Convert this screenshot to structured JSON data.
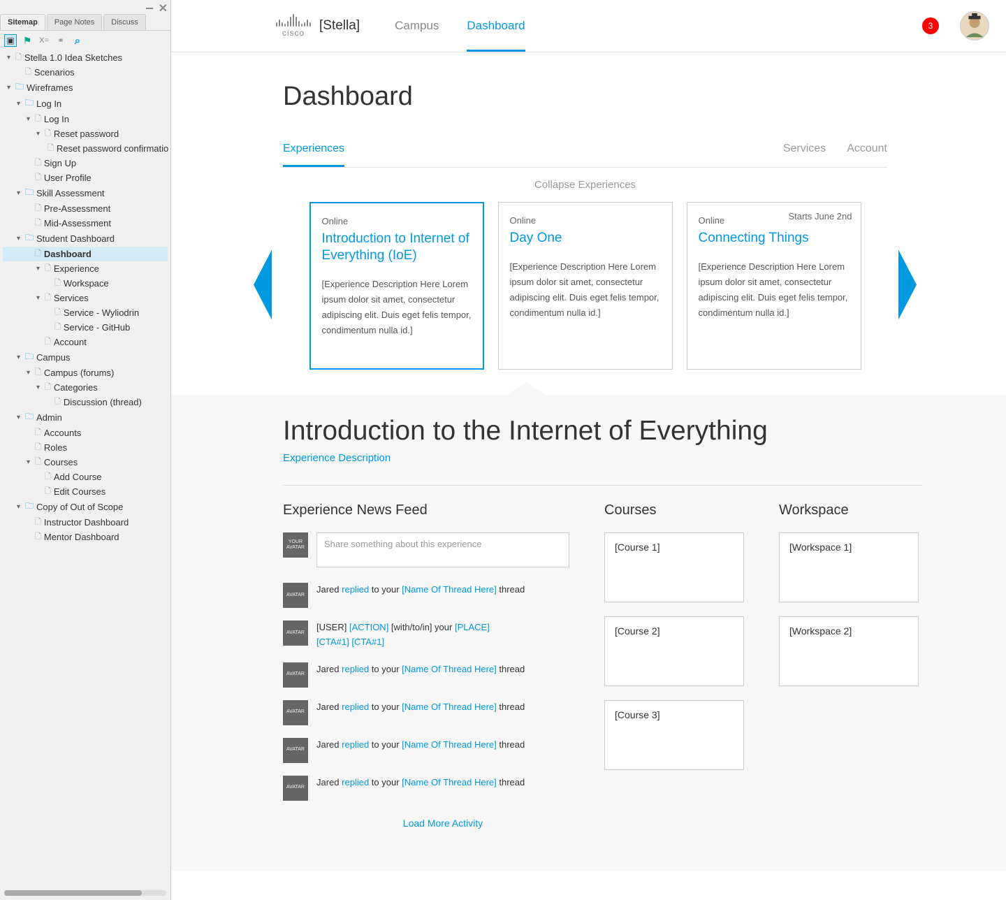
{
  "sidebar": {
    "tabs": [
      "Sitemap",
      "Page Notes",
      "Discuss"
    ],
    "tree": [
      {
        "indent": 0,
        "caret": "▾",
        "type": "page",
        "label": "Stella 1.0 Idea Sketches"
      },
      {
        "indent": 1,
        "caret": "",
        "type": "page",
        "label": "Scenarios"
      },
      {
        "indent": 0,
        "caret": "▾",
        "type": "folder",
        "label": "Wireframes"
      },
      {
        "indent": 1,
        "caret": "▾",
        "type": "folder",
        "label": "Log In"
      },
      {
        "indent": 2,
        "caret": "▾",
        "type": "page",
        "label": "Log In"
      },
      {
        "indent": 3,
        "caret": "▾",
        "type": "page",
        "label": "Reset password"
      },
      {
        "indent": 4,
        "caret": "",
        "type": "page",
        "label": "Reset password confirmatio"
      },
      {
        "indent": 2,
        "caret": "",
        "type": "page",
        "label": "Sign Up"
      },
      {
        "indent": 2,
        "caret": "",
        "type": "page",
        "label": "User Profile"
      },
      {
        "indent": 1,
        "caret": "▾",
        "type": "folder",
        "label": "Skill Assessment"
      },
      {
        "indent": 2,
        "caret": "",
        "type": "page",
        "label": "Pre-Assessment"
      },
      {
        "indent": 2,
        "caret": "",
        "type": "page",
        "label": "Mid-Assessment"
      },
      {
        "indent": 1,
        "caret": "▾",
        "type": "folder",
        "label": "Student Dashboard"
      },
      {
        "indent": 2,
        "caret": "",
        "type": "page",
        "label": "Dashboard",
        "selected": true
      },
      {
        "indent": 3,
        "caret": "▾",
        "type": "page",
        "label": "Experience"
      },
      {
        "indent": 4,
        "caret": "",
        "type": "page",
        "label": "Workspace"
      },
      {
        "indent": 3,
        "caret": "▾",
        "type": "page",
        "label": "Services"
      },
      {
        "indent": 4,
        "caret": "",
        "type": "page",
        "label": "Service - Wyliodrin"
      },
      {
        "indent": 4,
        "caret": "",
        "type": "page",
        "label": "Service - GitHub"
      },
      {
        "indent": 3,
        "caret": "",
        "type": "page",
        "label": "Account"
      },
      {
        "indent": 1,
        "caret": "▾",
        "type": "folder",
        "label": "Campus"
      },
      {
        "indent": 2,
        "caret": "▾",
        "type": "page",
        "label": "Campus (forums)"
      },
      {
        "indent": 3,
        "caret": "▾",
        "type": "page",
        "label": "Categories"
      },
      {
        "indent": 4,
        "caret": "",
        "type": "page",
        "label": "Discussion (thread)"
      },
      {
        "indent": 1,
        "caret": "▾",
        "type": "folder",
        "label": "Admin"
      },
      {
        "indent": 2,
        "caret": "",
        "type": "page",
        "label": "Accounts"
      },
      {
        "indent": 2,
        "caret": "",
        "type": "page",
        "label": "Roles"
      },
      {
        "indent": 2,
        "caret": "▾",
        "type": "page",
        "label": "Courses"
      },
      {
        "indent": 3,
        "caret": "",
        "type": "page",
        "label": "Add Course"
      },
      {
        "indent": 3,
        "caret": "",
        "type": "page",
        "label": "Edit Courses"
      },
      {
        "indent": 1,
        "caret": "▾",
        "type": "folder",
        "label": "Copy of Out of Scope"
      },
      {
        "indent": 2,
        "caret": "",
        "type": "page",
        "label": "Instructor Dashboard"
      },
      {
        "indent": 2,
        "caret": "",
        "type": "page",
        "label": "Mentor Dashboard"
      }
    ]
  },
  "header": {
    "brand": "[Stella]",
    "nav": [
      "Campus",
      "Dashboard"
    ],
    "badge": "3"
  },
  "page": {
    "title": "Dashboard",
    "subtabs": [
      "Experiences",
      "Services",
      "Account"
    ],
    "collapse": "Collapse Experiences"
  },
  "cards": [
    {
      "tag": "Online",
      "title": "Introduction to Internet of Everything (IoE)",
      "desc": "[Experience Description Here Lorem ipsum dolor sit amet, consectetur adipiscing elit. Duis eget felis tempor, condimentum nulla id.]"
    },
    {
      "tag": "Online",
      "title": "Day One",
      "desc": "[Experience Description Here Lorem ipsum dolor sit amet, consectetur adipiscing elit. Duis eget felis tempor, condimentum nulla id.]"
    },
    {
      "tag": "Online",
      "starts": "Starts June 2nd",
      "title": "Connecting Things",
      "desc": "[Experience Description Here Lorem ipsum dolor sit amet, consectetur adipiscing elit. Duis eget felis tempor, condimentum nulla id.]"
    }
  ],
  "detail": {
    "title": "Introduction to the Internet of Everything",
    "link": "Experience Description",
    "feed_head": "Experience News Feed",
    "courses_head": "Courses",
    "ws_head": "Workspace",
    "share_avatar": "YOUR AVATAR",
    "share_placeholder": "Share something about this experience",
    "load_more": "Load More Activity",
    "avatar_label": "AVATAR",
    "feed": [
      {
        "user": "Jared",
        "action": "replied",
        "mid": "to your",
        "place": "[Name Of Thread Here]",
        "tail": "thread"
      },
      {
        "user": "[USER]",
        "action": "[ACTION]",
        "mid": "[with/to/in] your",
        "place": "[PLACE]",
        "cta1": "[CTA#1]",
        "cta2": "[CTA#1]"
      },
      {
        "user": "Jared",
        "action": "replied",
        "mid": "to your",
        "place": "[Name Of Thread Here]",
        "tail": "thread"
      },
      {
        "user": "Jared",
        "action": "replied",
        "mid": "to your",
        "place": "[Name Of Thread Here]",
        "tail": "thread"
      },
      {
        "user": "Jared",
        "action": "replied",
        "mid": "to your",
        "place": "[Name Of Thread Here]",
        "tail": "thread"
      },
      {
        "user": "Jared",
        "action": "replied",
        "mid": "to your",
        "place": "[Name Of Thread Here]",
        "tail": "thread"
      }
    ],
    "courses": [
      "[Course 1]",
      "[Course 2]",
      "[Course 3]"
    ],
    "workspaces": [
      "[Workspace 1]",
      "[Workspace 2]"
    ]
  }
}
